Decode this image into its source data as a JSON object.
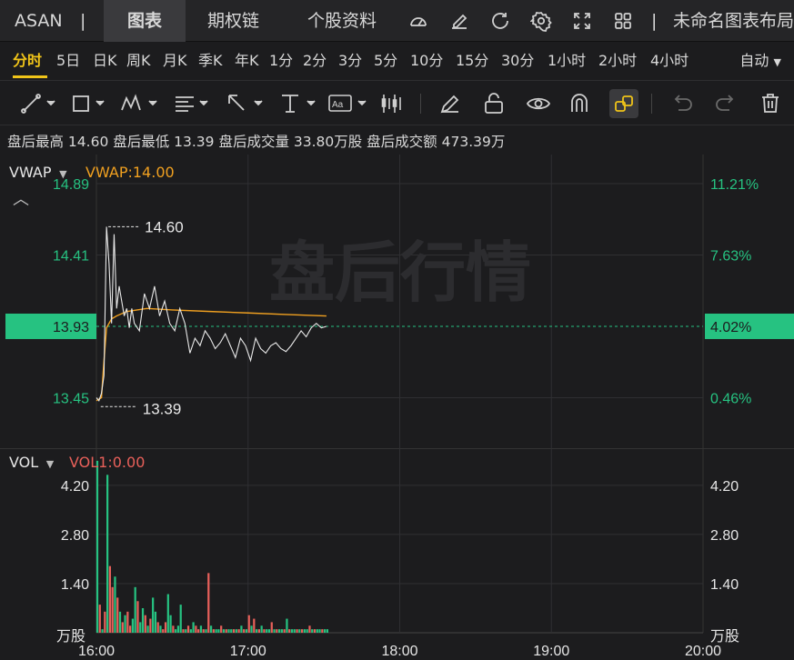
{
  "nav": {
    "ticker": "ASAN",
    "separator": "|",
    "tabs": [
      "图表",
      "期权链",
      "个股资料"
    ],
    "icons": [
      "speedometer-icon",
      "edit-icon",
      "refresh-icon",
      "settings-icon",
      "fullscreen-icon",
      "grid-icon"
    ],
    "layout_name": "未命名图表布局"
  },
  "periods": {
    "items": [
      "分时",
      "5日",
      "日K",
      "周K",
      "月K",
      "季K",
      "年K",
      "1分",
      "2分",
      "3分",
      "5分",
      "10分",
      "15分",
      "30分",
      "1小时",
      "2小时",
      "4小时"
    ],
    "active": "分时",
    "mode": "自动"
  },
  "toolbar": {
    "tools": [
      "line-tool-icon",
      "rectangle-tool-icon",
      "pattern-tool-icon",
      "fibonacci-tool-icon",
      "arrow-tool-icon",
      "measure-tool-icon",
      "text-tool-icon",
      "candlestick-icon",
      "pen-icon",
      "lock-icon",
      "eye-icon",
      "magnet-icon",
      "link-icon",
      "undo-icon",
      "redo-icon",
      "trash-icon"
    ]
  },
  "stats": {
    "text": "盘后最高 14.60 盘后最低 13.39 盘后成交量 33.80万股 盘后成交额 473.39万"
  },
  "main": {
    "indicator": "VWAP",
    "indicator_value": "VWAP:14.00",
    "watermark": "盘后行情",
    "high_label": "14.60",
    "low_label": "13.39",
    "current_price": "13.93",
    "current_pct": "4.02%"
  },
  "volume": {
    "indicator": "VOL",
    "indicator_value": "VOL1:0.00",
    "unit_left": "万股",
    "unit_right": "万股"
  },
  "colors": {
    "up": "#26c281",
    "down": "#e8605a",
    "vwap": "#f0a020",
    "price_line": "#e8e8e8",
    "accent": "#f0c419"
  },
  "chart_data": [
    {
      "type": "line",
      "title": "",
      "x_ticks": [
        "16:00",
        "17:00",
        "18:00",
        "19:00",
        "20:00"
      ],
      "y_ticks_left": [
        "14.89",
        "14.41",
        "13.93",
        "13.45"
      ],
      "y_ticks_right": [
        "11.21%",
        "7.63%",
        "4.02%",
        "0.46%"
      ],
      "ylim": [
        13.3,
        15.0
      ],
      "series": [
        {
          "name": "",
          "x": [
            "16:00",
            "16:01",
            "16:02",
            "16:03",
            "16:04",
            "16:05",
            "16:06",
            "16:07",
            "16:08",
            "16:09",
            "16:10",
            "16:11",
            "16:12",
            "16:13",
            "16:14",
            "16:15",
            "16:17",
            "16:19",
            "16:21",
            "16:23",
            "16:25",
            "16:27",
            "16:29",
            "16:31",
            "16:33",
            "16:35",
            "16:37",
            "16:39",
            "16:41",
            "16:43",
            "16:45",
            "16:47",
            "16:49",
            "16:51",
            "16:53",
            "16:55",
            "16:57",
            "16:59",
            "17:01",
            "17:03",
            "17:05",
            "17:07",
            "17:09",
            "17:11",
            "17:13",
            "17:15",
            "17:17",
            "17:19",
            "17:21",
            "17:23",
            "17:25",
            "17:27",
            "17:29",
            "17:31"
          ],
          "values": [
            13.45,
            13.43,
            13.48,
            13.6,
            14.6,
            14.35,
            13.95,
            14.55,
            14.05,
            14.2,
            14.1,
            14.0,
            14.05,
            13.92,
            14.05,
            13.95,
            13.9,
            14.15,
            14.05,
            14.2,
            14.0,
            14.1,
            13.95,
            13.9,
            14.05,
            13.95,
            13.75,
            13.85,
            13.8,
            13.9,
            13.85,
            13.78,
            13.82,
            13.88,
            13.8,
            13.72,
            13.85,
            13.8,
            13.7,
            13.85,
            13.78,
            13.75,
            13.8,
            13.82,
            13.78,
            13.76,
            13.8,
            13.85,
            13.9,
            13.86,
            13.92,
            13.95,
            13.92,
            13.93
          ]
        },
        {
          "name": "VWAP",
          "x": [
            "16:00",
            "16:02",
            "16:03",
            "16:04",
            "16:06",
            "16:08",
            "16:12",
            "16:20",
            "16:30",
            "16:45",
            "17:00",
            "17:15",
            "17:31"
          ],
          "values": [
            13.43,
            13.45,
            13.7,
            13.92,
            13.98,
            14.0,
            14.03,
            14.05,
            14.04,
            14.03,
            14.02,
            14.01,
            14.0
          ]
        }
      ]
    },
    {
      "type": "bar",
      "title": "",
      "x_ticks": [
        "16:00",
        "17:00",
        "18:00",
        "19:00",
        "20:00"
      ],
      "y_ticks": [
        "4.20",
        "2.80",
        "1.40"
      ],
      "ylim": [
        0,
        5.0
      ],
      "x": [
        "16:00",
        "16:01",
        "16:02",
        "16:03",
        "16:04",
        "16:05",
        "16:06",
        "16:07",
        "16:08",
        "16:09",
        "16:10",
        "16:11",
        "16:12",
        "16:13",
        "16:14",
        "16:15",
        "16:16",
        "16:17",
        "16:18",
        "16:19",
        "16:20",
        "16:21",
        "16:22",
        "16:23",
        "16:24",
        "16:25",
        "16:26",
        "16:27",
        "16:28",
        "16:29",
        "16:30",
        "16:31",
        "16:32",
        "16:33",
        "16:34",
        "16:35",
        "16:36",
        "16:37",
        "16:38",
        "16:39",
        "16:40",
        "16:41",
        "16:42",
        "16:43",
        "16:44",
        "16:45",
        "16:46",
        "16:47",
        "16:48",
        "16:49",
        "16:50",
        "16:51",
        "16:52",
        "16:53",
        "16:54",
        "16:55",
        "16:56",
        "16:57",
        "16:58",
        "16:59",
        "17:00",
        "17:01",
        "17:02",
        "17:03",
        "17:04",
        "17:05",
        "17:06",
        "17:07",
        "17:08",
        "17:09",
        "17:10",
        "17:11",
        "17:12",
        "17:13",
        "17:14",
        "17:15",
        "17:16",
        "17:17",
        "17:18",
        "17:19",
        "17:20",
        "17:21",
        "17:22",
        "17:23",
        "17:24",
        "17:25",
        "17:26",
        "17:27",
        "17:28",
        "17:29",
        "17:30",
        "17:31"
      ],
      "values": [
        4.9,
        0.8,
        0.1,
        0.6,
        4.5,
        1.9,
        1.3,
        1.6,
        1.0,
        0.6,
        0.3,
        0.5,
        0.6,
        0.2,
        0.4,
        1.3,
        0.9,
        0.3,
        0.7,
        0.5,
        0.2,
        0.4,
        1.0,
        0.6,
        0.3,
        0.2,
        0.1,
        0.3,
        1.1,
        0.5,
        0.2,
        0.1,
        0.2,
        0.8,
        0.1,
        0.1,
        0.2,
        0.1,
        0.3,
        0.2,
        0.1,
        0.2,
        0.1,
        0.1,
        1.7,
        0.2,
        0.1,
        0.1,
        0.1,
        0.2,
        0.1,
        0.1,
        0.1,
        0.1,
        0.1,
        0.1,
        0.1,
        0.2,
        0.1,
        0.1,
        0.5,
        0.2,
        0.4,
        0.1,
        0.1,
        0.2,
        0.1,
        0.1,
        0.1,
        0.3,
        0.1,
        0.1,
        0.1,
        0.1,
        0.1,
        0.4,
        0.1,
        0.1,
        0.1,
        0.1,
        0.1,
        0.1,
        0.1,
        0.1,
        0.2,
        0.1,
        0.1,
        0.1,
        0.1,
        0.1,
        0.1,
        0.1
      ],
      "colors": [
        "up",
        "down",
        "up",
        "down",
        "up",
        "down",
        "down",
        "up",
        "down",
        "up",
        "down",
        "up",
        "down",
        "down",
        "up",
        "up",
        "down",
        "up",
        "up",
        "down",
        "up",
        "down",
        "up",
        "up",
        "down",
        "up",
        "down",
        "down",
        "up",
        "up",
        "down",
        "up",
        "up",
        "up",
        "down",
        "up",
        "down",
        "up",
        "up",
        "down",
        "down",
        "up",
        "down",
        "up",
        "down",
        "up",
        "down",
        "up",
        "up",
        "down",
        "up",
        "down",
        "up",
        "up",
        "down",
        "up",
        "down",
        "up",
        "down",
        "up",
        "down",
        "up",
        "down",
        "up",
        "down",
        "up",
        "down",
        "up",
        "up",
        "down",
        "up",
        "down",
        "up",
        "up",
        "down",
        "up",
        "down",
        "up",
        "up",
        "down",
        "up",
        "down",
        "up",
        "up",
        "down",
        "up",
        "down",
        "up",
        "up",
        "down",
        "up",
        "up"
      ]
    }
  ]
}
